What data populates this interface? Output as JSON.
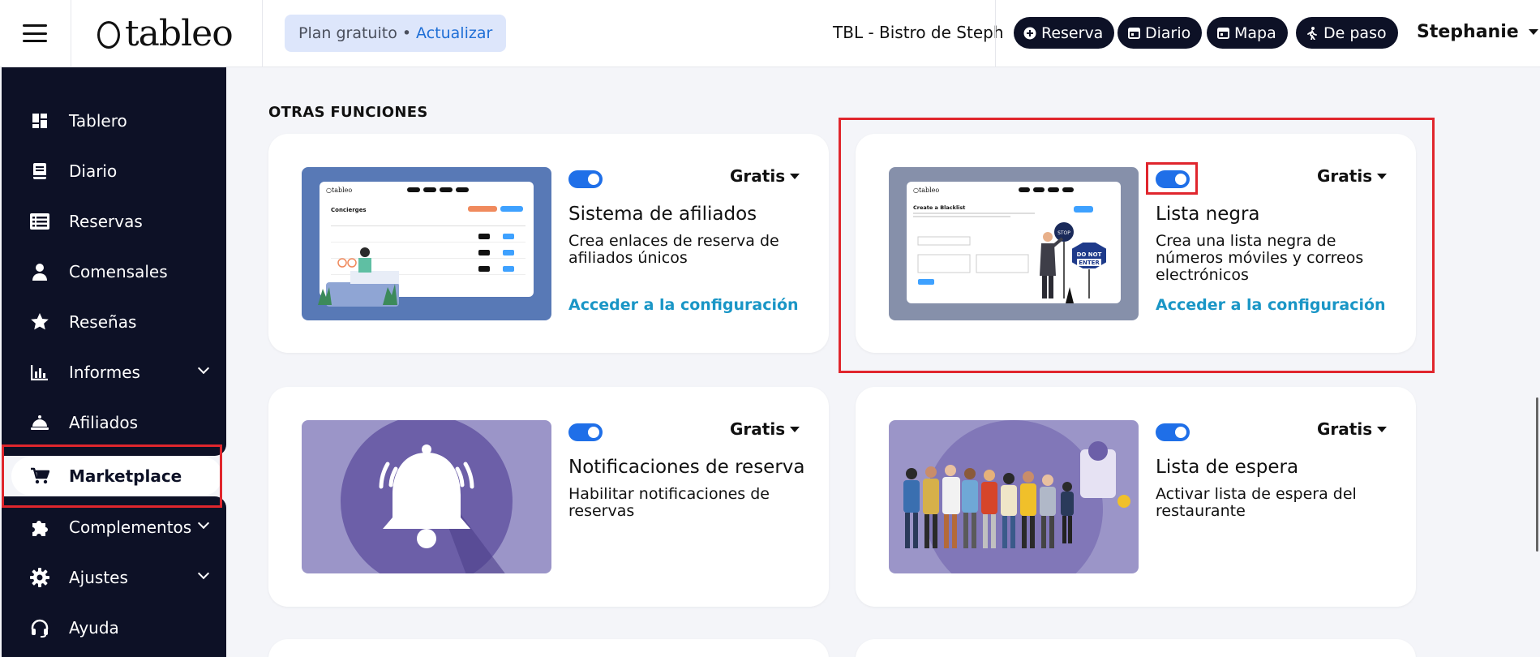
{
  "header": {
    "logo_text": "tableo",
    "plan_label": "Plan gratuito",
    "plan_separator": "•",
    "plan_upgrade": "Actualizar",
    "venue_name": "TBL - Bistro de Steph",
    "buttons": [
      {
        "label": "Reserva",
        "icon": "plus-circle-icon"
      },
      {
        "label": "Diario",
        "icon": "calendar-icon"
      },
      {
        "label": "Mapa",
        "icon": "calendar-icon"
      },
      {
        "label": "De paso",
        "icon": "walking-icon"
      }
    ],
    "user_name": "Stephanie"
  },
  "sidebar": {
    "items": [
      {
        "label": "Tablero",
        "icon": "dashboard-icon"
      },
      {
        "label": "Diario",
        "icon": "book-icon"
      },
      {
        "label": "Reservas",
        "icon": "list-icon"
      },
      {
        "label": "Comensales",
        "icon": "user-icon"
      },
      {
        "label": "Reseñas",
        "icon": "star-icon"
      },
      {
        "label": "Informes",
        "icon": "bar-chart-icon",
        "expandable": true
      },
      {
        "label": "Afiliados",
        "icon": "cloche-icon"
      },
      {
        "label": "Marketplace",
        "icon": "cart-icon",
        "active": true
      },
      {
        "label": "Complementos",
        "icon": "puzzle-icon",
        "expandable": true
      },
      {
        "label": "Ajustes",
        "icon": "gear-icon",
        "expandable": true
      },
      {
        "label": "Ayuda",
        "icon": "headset-icon"
      }
    ]
  },
  "main": {
    "section_title": "OTRAS FUNCIONES",
    "cards": [
      {
        "title": "Sistema de afiliados",
        "description": "Crea enlaces de reserva de afiliados únicos",
        "price": "Gratis",
        "link": "Acceder a la configuración",
        "enabled": true
      },
      {
        "title": "Lista negra",
        "description": "Crea una lista negra de números móviles y correos electrónicos",
        "price": "Gratis",
        "link": "Acceder a la configuración",
        "enabled": true
      },
      {
        "title": "Notificaciones de reserva",
        "description": "Habilitar notificaciones de reservas",
        "price": "Gratis",
        "link": "",
        "enabled": true
      },
      {
        "title": "Lista de espera",
        "description": "Activar lista de espera del restaurante",
        "price": "Gratis",
        "link": "",
        "enabled": true
      }
    ],
    "thumb_text": {
      "concierges_title": "Concierges",
      "blacklist_title": "Create a Blacklist",
      "stop_sign": "STOP",
      "do_not_enter_1": "DO NOT",
      "do_not_enter_2": "ENTER"
    }
  },
  "colors": {
    "sidebar_bg": "#0d1126",
    "accent_blue": "#1f6fe8",
    "link_teal": "#1a96c6",
    "highlight_red": "#e0262d",
    "plan_pill_bg": "#dde6fb"
  }
}
